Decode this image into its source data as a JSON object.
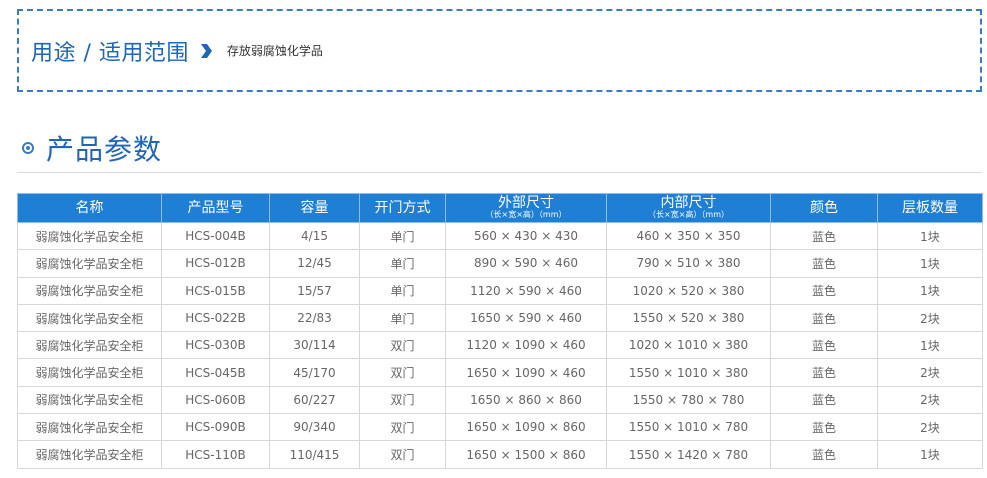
{
  "usage": {
    "title": "用途 / 适用范围",
    "value": "存放弱腐蚀化学品"
  },
  "params": {
    "title": "产品参数"
  },
  "table": {
    "headers": [
      {
        "label": "名称",
        "sub": ""
      },
      {
        "label": "产品型号",
        "sub": ""
      },
      {
        "label": "容量",
        "sub": ""
      },
      {
        "label": "开门方式",
        "sub": ""
      },
      {
        "label": "外部尺寸",
        "sub": "（长×宽×高）（mm）"
      },
      {
        "label": "内部尺寸",
        "sub": "（长×宽×高）（mm）"
      },
      {
        "label": "颜色",
        "sub": ""
      },
      {
        "label": "层板数量",
        "sub": ""
      }
    ],
    "rows": [
      [
        "弱腐蚀化学品安全柜",
        "HCS-004B",
        "4/15",
        "单门",
        "560 × 430 × 430",
        "460 × 350 × 350",
        "蓝色",
        "1块"
      ],
      [
        "弱腐蚀化学品安全柜",
        "HCS-012B",
        "12/45",
        "单门",
        "890 × 590 × 460",
        "790 × 510 × 380",
        "蓝色",
        "1块"
      ],
      [
        "弱腐蚀化学品安全柜",
        "HCS-015B",
        "15/57",
        "单门",
        "1120 × 590 × 460",
        "1020 × 520 × 380",
        "蓝色",
        "1块"
      ],
      [
        "弱腐蚀化学品安全柜",
        "HCS-022B",
        "22/83",
        "单门",
        "1650 × 590 × 460",
        "1550 × 520 × 380",
        "蓝色",
        "2块"
      ],
      [
        "弱腐蚀化学品安全柜",
        "HCS-030B",
        "30/114",
        "双门",
        "1120 × 1090 × 460",
        "1020 × 1010 × 380",
        "蓝色",
        "1块"
      ],
      [
        "弱腐蚀化学品安全柜",
        "HCS-045B",
        "45/170",
        "双门",
        "1650 × 1090 × 460",
        "1550 × 1010 × 380",
        "蓝色",
        "2块"
      ],
      [
        "弱腐蚀化学品安全柜",
        "HCS-060B",
        "60/227",
        "双门",
        "1650 × 860 × 860",
        "1550 × 780 × 780",
        "蓝色",
        "2块"
      ],
      [
        "弱腐蚀化学品安全柜",
        "HCS-090B",
        "90/340",
        "双门",
        "1650 × 1090 × 860",
        "1550 × 1010 × 780",
        "蓝色",
        "2块"
      ],
      [
        "弱腐蚀化学品安全柜",
        "HCS-110B",
        "110/415",
        "双门",
        "1650 × 1500 × 860",
        "1550 × 1420 × 780",
        "蓝色",
        "1块"
      ]
    ]
  },
  "icons": {
    "usage_arrow": "chevron-right-icon",
    "params_bullet": "bullet-circle-icon"
  },
  "colors": {
    "accent": "#1f65b8",
    "header_bg": "#1e7fd4",
    "dashed_border": "#3a7ac6"
  }
}
